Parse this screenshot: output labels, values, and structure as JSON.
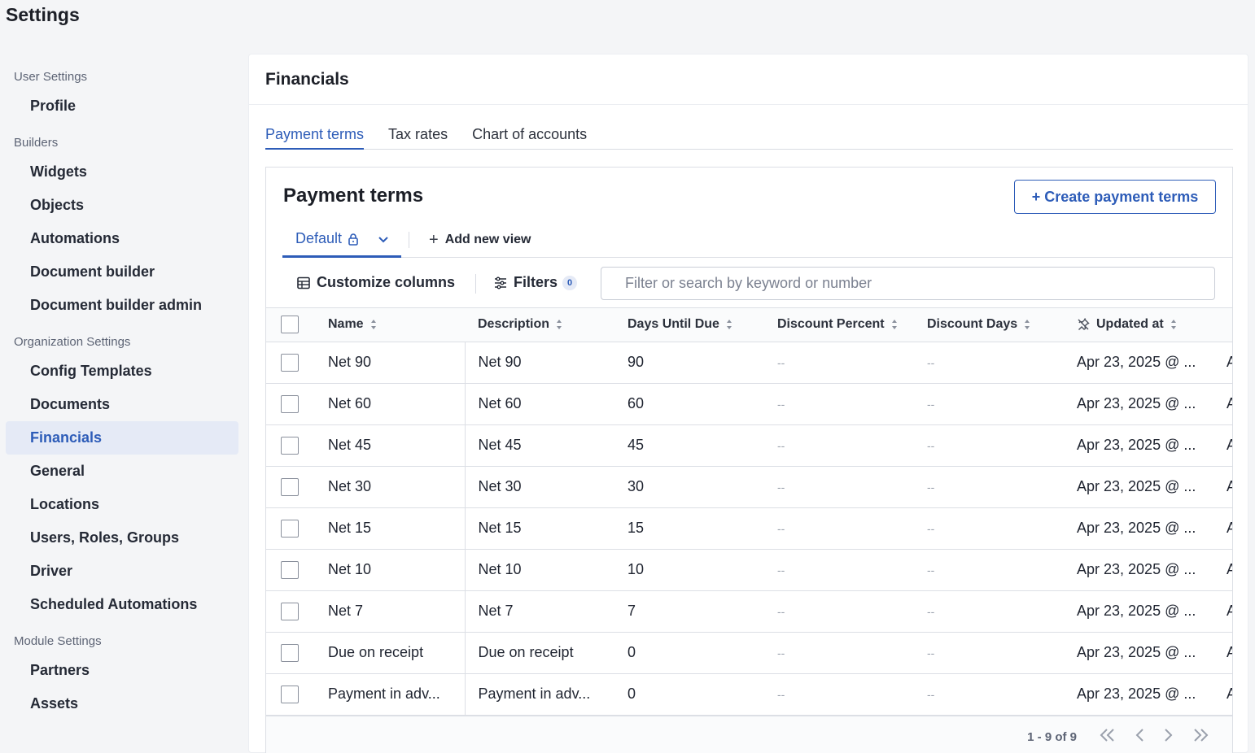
{
  "page_title": "Settings",
  "sidebar": {
    "groups": [
      {
        "label": "User Settings",
        "items": [
          "Profile"
        ]
      },
      {
        "label": "Builders",
        "items": [
          "Widgets",
          "Objects",
          "Automations",
          "Document builder",
          "Document builder admin"
        ]
      },
      {
        "label": "Organization Settings",
        "items": [
          "Config Templates",
          "Documents",
          "Financials",
          "General",
          "Locations",
          "Users, Roles, Groups",
          "Driver",
          "Scheduled Automations"
        ]
      },
      {
        "label": "Module Settings",
        "items": [
          "Partners",
          "Assets"
        ]
      }
    ],
    "active_item": "Financials"
  },
  "panel": {
    "title": "Financials",
    "tabs": [
      "Payment terms",
      "Tax rates",
      "Chart of accounts"
    ],
    "active_tab": "Payment terms"
  },
  "card": {
    "title": "Payment terms",
    "create_button": "+ Create payment terms",
    "view_default": "Default",
    "add_view": "Add new view",
    "customize_columns": "Customize columns",
    "filters": "Filters",
    "filters_count": "0",
    "search_placeholder": "Filter or search by keyword or number"
  },
  "table": {
    "columns": [
      "Name",
      "Description",
      "Days Until Due",
      "Discount Percent",
      "Discount Days",
      "Updated at"
    ],
    "rows": [
      {
        "name": "Net 90",
        "description": "Net 90",
        "days": "90",
        "pct": "--",
        "disc_days": "--",
        "updated": "Apr 23, 2025 @ ...",
        "extra": "A"
      },
      {
        "name": "Net 60",
        "description": "Net 60",
        "days": "60",
        "pct": "--",
        "disc_days": "--",
        "updated": "Apr 23, 2025 @ ...",
        "extra": "A"
      },
      {
        "name": "Net 45",
        "description": "Net 45",
        "days": "45",
        "pct": "--",
        "disc_days": "--",
        "updated": "Apr 23, 2025 @ ...",
        "extra": "A"
      },
      {
        "name": "Net 30",
        "description": "Net 30",
        "days": "30",
        "pct": "--",
        "disc_days": "--",
        "updated": "Apr 23, 2025 @ ...",
        "extra": "A"
      },
      {
        "name": "Net 15",
        "description": "Net 15",
        "days": "15",
        "pct": "--",
        "disc_days": "--",
        "updated": "Apr 23, 2025 @ ...",
        "extra": "A"
      },
      {
        "name": "Net 10",
        "description": "Net 10",
        "days": "10",
        "pct": "--",
        "disc_days": "--",
        "updated": "Apr 23, 2025 @ ...",
        "extra": "A"
      },
      {
        "name": "Net 7",
        "description": "Net 7",
        "days": "7",
        "pct": "--",
        "disc_days": "--",
        "updated": "Apr 23, 2025 @ ...",
        "extra": "A"
      },
      {
        "name": "Due on receipt",
        "description": "Due on receipt",
        "days": "0",
        "pct": "--",
        "disc_days": "--",
        "updated": "Apr 23, 2025 @ ...",
        "extra": "A"
      },
      {
        "name": "Payment in adv...",
        "description": "Payment in adv...",
        "days": "0",
        "pct": "--",
        "disc_days": "--",
        "updated": "Apr 23, 2025 @ ...",
        "extra": "A"
      }
    ]
  },
  "pagination": {
    "text": "1 - 9 of 9"
  },
  "colors": {
    "accent": "#2d5cb8",
    "active_bg": "#e5eaf6",
    "border": "#dcdfe5"
  }
}
